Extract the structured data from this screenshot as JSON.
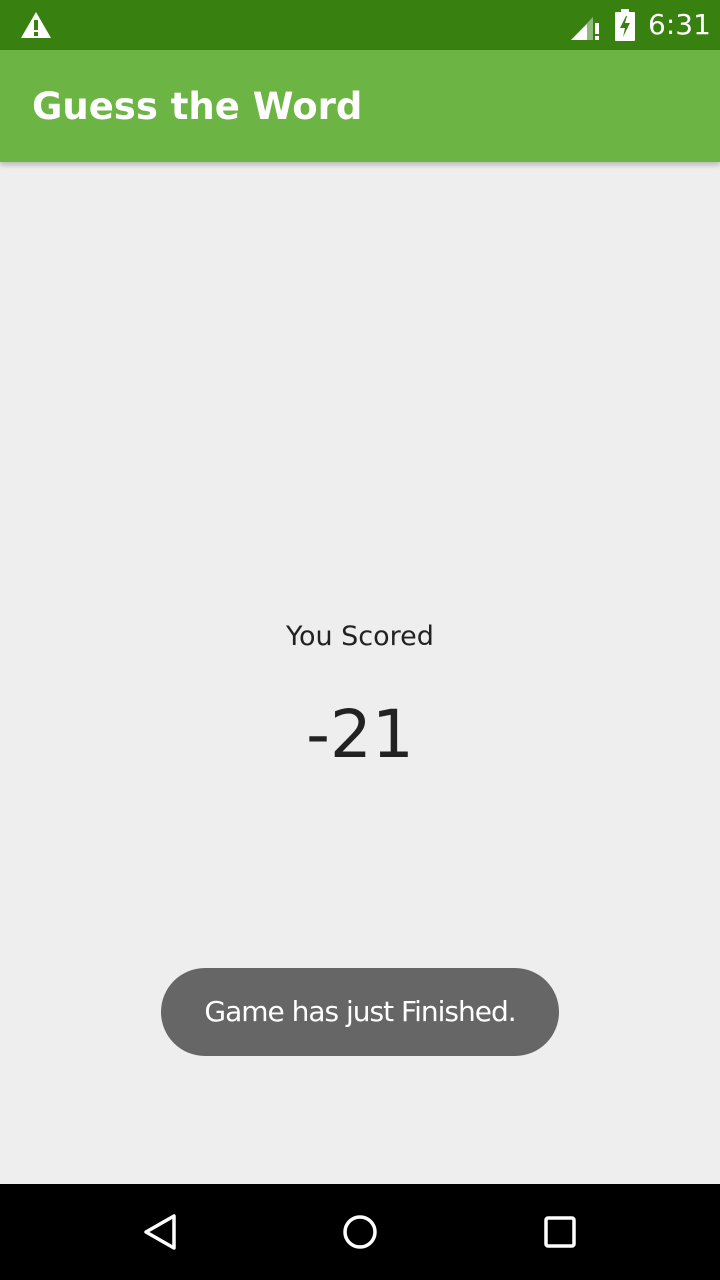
{
  "status_bar": {
    "time": "6:31",
    "icons": [
      "warning-icon",
      "signal-icon",
      "battery-charging-icon"
    ]
  },
  "app_bar": {
    "title": "Guess the Word"
  },
  "score": {
    "label": "You Scored",
    "value": "-21"
  },
  "toast": {
    "message": "Game has just Finished."
  },
  "nav_bar": {
    "icons": [
      "back-icon",
      "home-icon",
      "recents-icon"
    ]
  },
  "colors": {
    "status_bar": "#38800f",
    "app_bar": "#6cb443",
    "background": "#eeeeee",
    "toast": "#666666",
    "nav_bar": "#000000"
  }
}
